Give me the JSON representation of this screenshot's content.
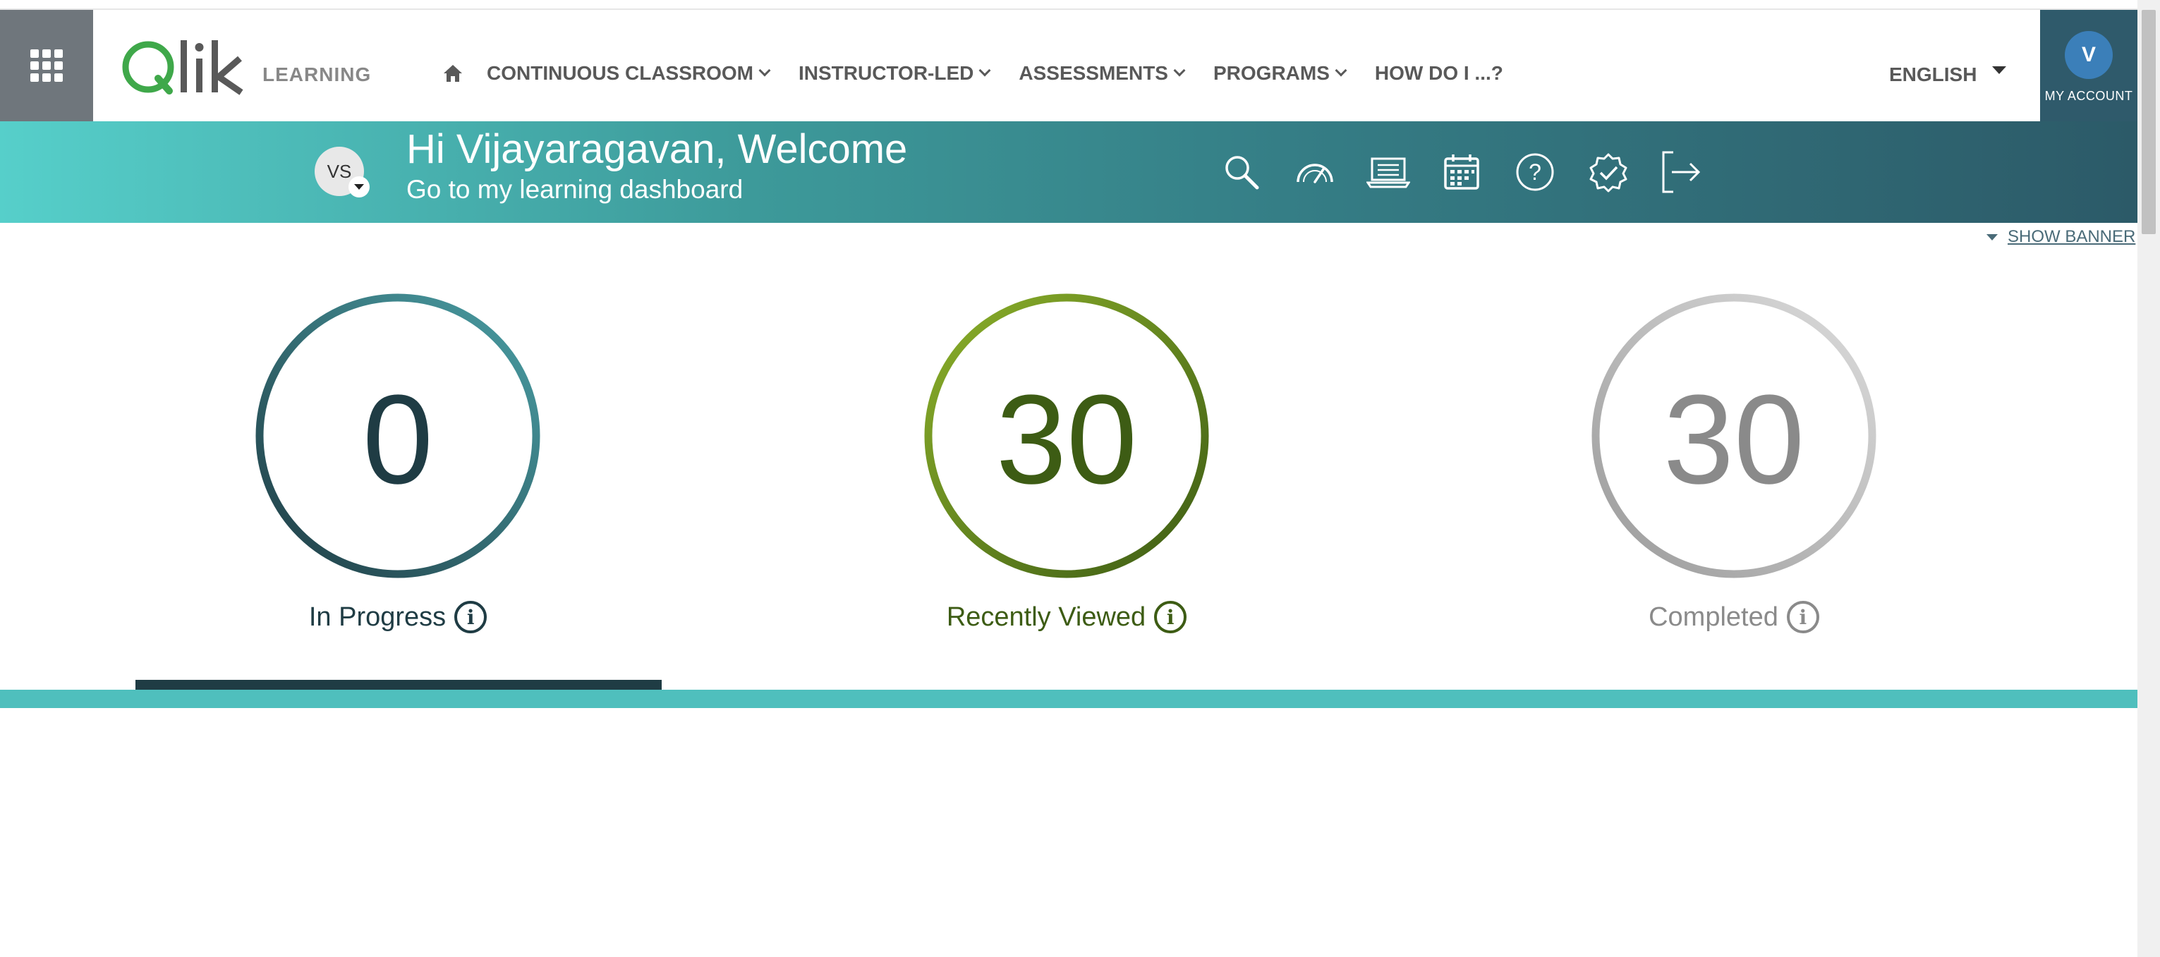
{
  "header": {
    "brand": "Qlik",
    "section_label": "LEARNING",
    "nav_items": [
      {
        "label": "CONTINUOUS CLASSROOM",
        "icon": "chevron-down-icon"
      },
      {
        "label": "INSTRUCTOR-LED",
        "icon": "chevron-down-icon"
      },
      {
        "label": "ASSESSMENTS",
        "icon": "chevron-down-icon"
      },
      {
        "label": "PROGRAMS",
        "icon": "chevron-down-icon"
      },
      {
        "label": "HOW DO I ...?"
      }
    ],
    "language": "ENGLISH",
    "account": {
      "initial": "V",
      "label": "MY ACCOUNT"
    }
  },
  "banner": {
    "user_initials": "VS",
    "welcome": "Hi Vijayaragavan, Welcome",
    "dashboard_link": "Go to my learning dashboard",
    "icons": [
      "search-icon",
      "speedometer-icon",
      "laptop-icon",
      "calendar-icon",
      "help-icon",
      "badge-check-icon",
      "logout-icon"
    ]
  },
  "show_banner": "SHOW BANNER",
  "stats": [
    {
      "value": "0",
      "label": "In Progress",
      "color": "#1f3c44",
      "accent": "#4a9fa5"
    },
    {
      "value": "30",
      "label": "Recently Viewed",
      "color": "#3d5c14",
      "accent": "#8cb02a"
    },
    {
      "value": "30",
      "label": "Completed",
      "color": "#8a8a8a",
      "accent": "#d6d6d6"
    }
  ],
  "colors": {
    "banner_start": "#56cfca",
    "banner_end": "#2c5a68",
    "grid_button": "#6f767c",
    "account_bg": "#2f5a6b",
    "teal_strip": "#4fbfbd"
  }
}
